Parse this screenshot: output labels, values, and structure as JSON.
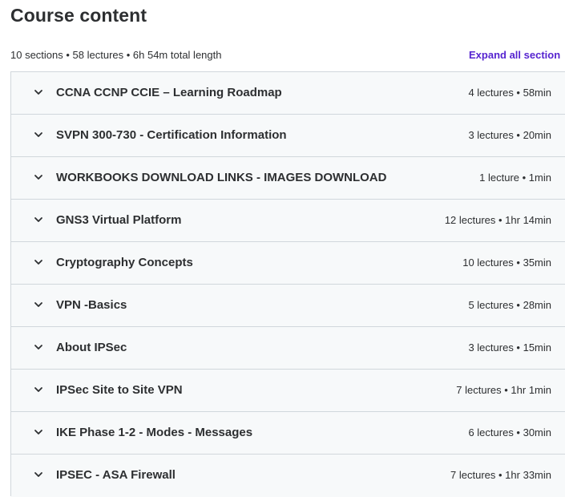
{
  "header": {
    "title": "Course content"
  },
  "summary": {
    "text": "10 sections • 58 lectures • 6h 54m total length",
    "expand_label": "Expand all section"
  },
  "sections": [
    {
      "title": "CCNA CCNP CCIE – Learning Roadmap",
      "meta": "4 lectures • 58min",
      "icon": "chevron-down-icon"
    },
    {
      "title": "SVPN 300-730 - Certification Information",
      "meta": "3 lectures • 20min",
      "icon": "chevron-down-icon"
    },
    {
      "title": "WORKBOOKS DOWNLOAD LINKS - IMAGES DOWNLOAD",
      "meta": "1 lecture • 1min",
      "icon": "chevron-down-icon"
    },
    {
      "title": "GNS3 Virtual Platform",
      "meta": "12 lectures • 1hr 14min",
      "icon": "chevron-down-icon"
    },
    {
      "title": "Cryptography Concepts",
      "meta": "10 lectures • 35min",
      "icon": "chevron-down-icon"
    },
    {
      "title": "VPN -Basics",
      "meta": "5 lectures • 28min",
      "icon": "chevron-down-icon"
    },
    {
      "title": "About IPSec",
      "meta": "3 lectures • 15min",
      "icon": "chevron-down-icon"
    },
    {
      "title": "IPSec Site to Site VPN",
      "meta": "7 lectures • 1hr 1min",
      "icon": "chevron-down-icon"
    },
    {
      "title": "IKE Phase 1-2 - Modes - Messages",
      "meta": "6 lectures • 30min",
      "icon": "chevron-down-icon"
    },
    {
      "title": "IPSEC - ASA Firewall",
      "meta": "7 lectures • 1hr 33min",
      "icon": "chevron-down-icon"
    }
  ],
  "colors": {
    "text": "#2d2f31",
    "accent": "#5624d0",
    "section_bg": "#f7f9fa",
    "border": "#d1d7dc"
  }
}
